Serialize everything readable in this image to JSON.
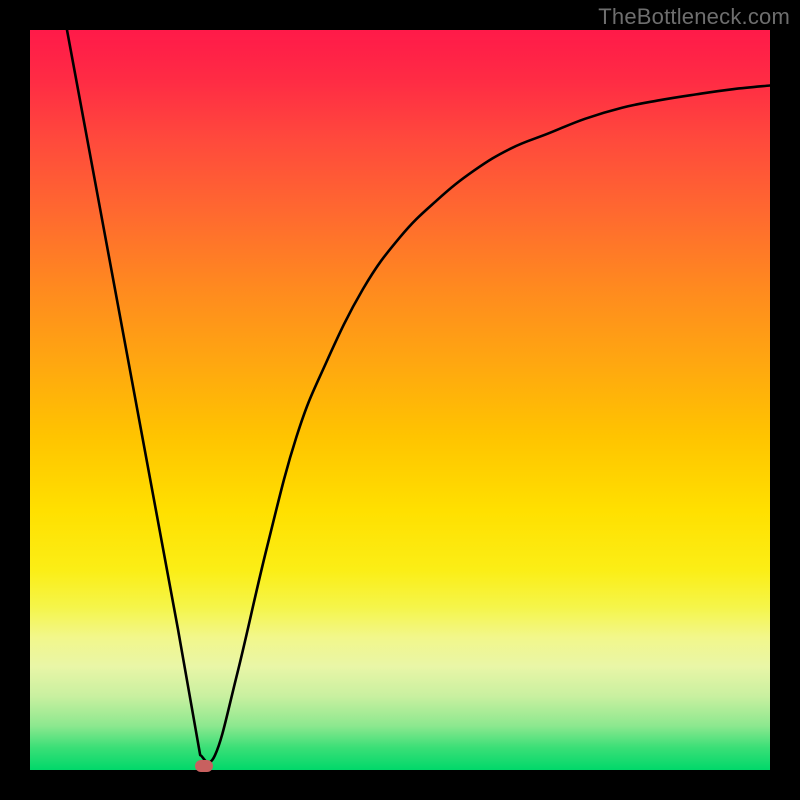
{
  "watermark": "TheBottleneck.com",
  "chart_data": {
    "type": "line",
    "title": "",
    "xlabel": "",
    "ylabel": "",
    "xlim": [
      0,
      100
    ],
    "ylim": [
      0,
      100
    ],
    "grid": false,
    "legend": false,
    "series": [
      {
        "name": "bottleneck-curve",
        "color": "#000000",
        "x": [
          5,
          10,
          15,
          20,
          23,
          25,
          28,
          32,
          36,
          40,
          45,
          50,
          55,
          60,
          65,
          70,
          75,
          80,
          85,
          90,
          95,
          100
        ],
        "y": [
          100,
          73,
          46,
          19,
          2,
          2,
          13,
          30,
          45,
          55,
          65,
          72,
          77,
          81,
          84,
          86,
          88,
          89.5,
          90.5,
          91.3,
          92,
          92.5
        ]
      }
    ],
    "annotations": [
      {
        "name": "minimum-marker",
        "x": 23.5,
        "y": 0.5,
        "color": "#c8605f"
      }
    ],
    "background_gradient": {
      "direction": "top-to-bottom",
      "stops": [
        {
          "pos": 0.0,
          "color": "#ff1a49"
        },
        {
          "pos": 0.5,
          "color": "#ffc400"
        },
        {
          "pos": 0.8,
          "color": "#f2f78a"
        },
        {
          "pos": 1.0,
          "color": "#00d86a"
        }
      ]
    }
  }
}
